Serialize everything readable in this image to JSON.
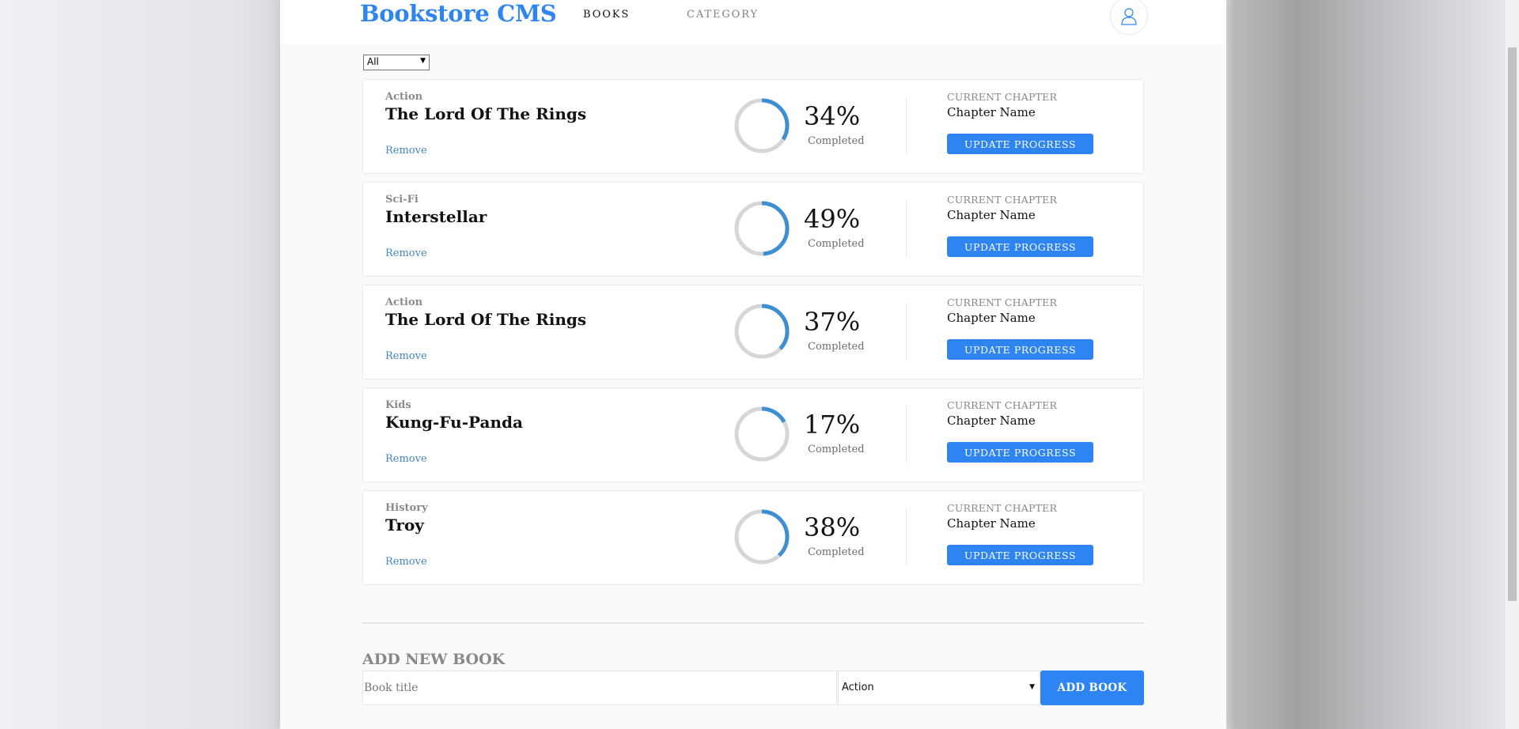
{
  "header": {
    "brand": "Bookstore CMS",
    "nav": [
      "BOOKS",
      "CATEGORY"
    ],
    "avatar_icon": "user-icon"
  },
  "filter": {
    "selected": "All"
  },
  "books": [
    {
      "genre": "Action",
      "title": "The Lord Of The Rings",
      "remove": "Remove",
      "progress": 34,
      "percent_text": "34%",
      "completed": "Completed",
      "chapter_label": "CURRENT CHAPTER",
      "chapter": "Chapter Name",
      "update": "UPDATE PROGRESS"
    },
    {
      "genre": "Sci-Fi",
      "title": "Interstellar",
      "remove": "Remove",
      "progress": 49,
      "percent_text": "49%",
      "completed": "Completed",
      "chapter_label": "CURRENT CHAPTER",
      "chapter": "Chapter Name",
      "update": "UPDATE PROGRESS"
    },
    {
      "genre": "Action",
      "title": "The Lord Of The Rings",
      "remove": "Remove",
      "progress": 37,
      "percent_text": "37%",
      "completed": "Completed",
      "chapter_label": "CURRENT CHAPTER",
      "chapter": "Chapter Name",
      "update": "UPDATE PROGRESS"
    },
    {
      "genre": "Kids",
      "title": "Kung-Fu-Panda",
      "remove": "Remove",
      "progress": 17,
      "percent_text": "17%",
      "completed": "Completed",
      "chapter_label": "CURRENT CHAPTER",
      "chapter": "Chapter Name",
      "update": "UPDATE PROGRESS"
    },
    {
      "genre": "History",
      "title": "Troy",
      "remove": "Remove",
      "progress": 38,
      "percent_text": "38%",
      "completed": "Completed",
      "chapter_label": "CURRENT CHAPTER",
      "chapter": "Chapter Name",
      "update": "UPDATE PROGRESS"
    }
  ],
  "add_form": {
    "heading": "ADD NEW BOOK",
    "title_placeholder": "Book title",
    "category_selected": "Action",
    "submit": "ADD BOOK"
  },
  "colors": {
    "accent": "#2e84f0",
    "progress_arc": "#379cf6",
    "progress_track": "#e8e8e8",
    "remove_link": "#4386bf"
  }
}
